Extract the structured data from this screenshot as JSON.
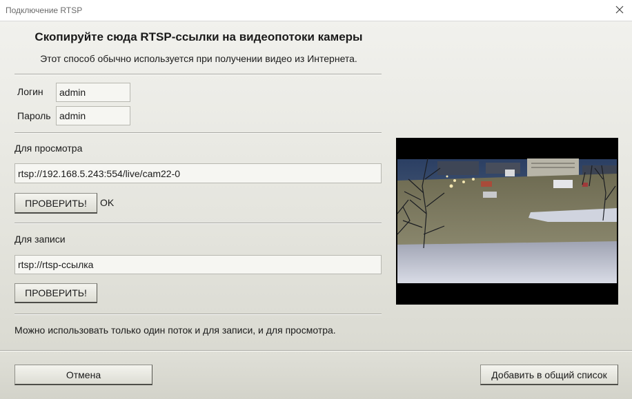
{
  "window": {
    "title": "Подключение RTSP",
    "close_icon": "close-icon"
  },
  "header": {
    "heading": "Скопируйте сюда RTSP-ссылки на видеопотоки камеры",
    "subtitle": "Этот способ обычно используется при получении видео из Интернета."
  },
  "credentials": {
    "login_label": "Логин",
    "login_value": "admin",
    "password_label": "Пароль",
    "password_value": "admin"
  },
  "view_stream": {
    "label": "Для просмотра",
    "url": "rtsp://192.168.5.243:554/live/cam22-0",
    "check_button": "ПРОВЕРИТЬ!",
    "status": "OK"
  },
  "record_stream": {
    "label": "Для записи",
    "url": "rtsp://rtsp-ссылка",
    "check_button": "ПРОВЕРИТЬ!"
  },
  "note": "Можно использовать только один поток и для записи, и для просмотра.",
  "footer": {
    "cancel_button": "Отмена",
    "add_button": "Добавить в общий список"
  },
  "colors": {
    "background_top": "#f1f1ed",
    "background_bottom": "#d6d6cd",
    "preview_frame": "#000000"
  }
}
